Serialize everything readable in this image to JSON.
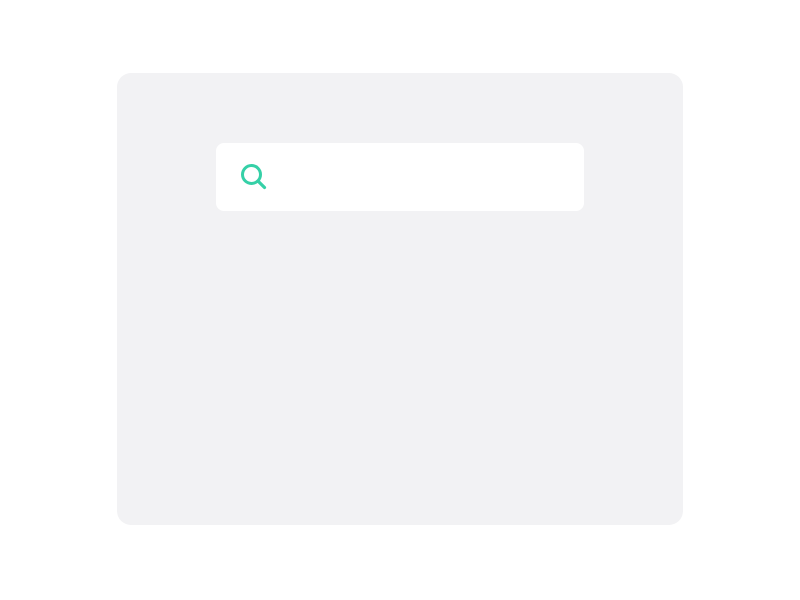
{
  "search": {
    "icon": "search-icon",
    "value": "",
    "placeholder": ""
  },
  "colors": {
    "page_background": "#ffffff",
    "panel_background": "#f2f2f4",
    "search_background": "#ffffff",
    "accent": "#35d0a7"
  }
}
